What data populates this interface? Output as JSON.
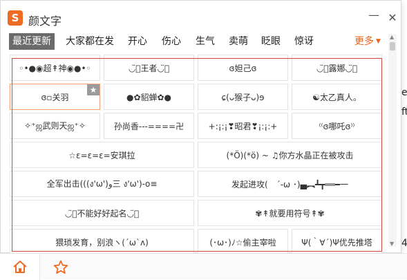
{
  "window": {
    "logo_letter": "S",
    "title": "颜文字",
    "minimize_glyph": "—",
    "close_glyph": "✕"
  },
  "tabs": [
    {
      "label": "最近更新",
      "active": true
    },
    {
      "label": "大家都在发"
    },
    {
      "label": "开心"
    },
    {
      "label": "伤心"
    },
    {
      "label": "生气"
    },
    {
      "label": "卖萌"
    },
    {
      "label": "眨眼"
    },
    {
      "label": "惊讶"
    },
    {
      "label": "更多",
      "more": true
    }
  ],
  "grid": [
    {
      "text": "◦•●◉超↟神◉●•◦"
    },
    {
      "text": "◡̈⃝王者◡̈⃝"
    },
    {
      "text": "ɞ妲己ɞ"
    },
    {
      "text": "◡̈⃝露娜◡̈⃝"
    },
    {
      "text": "ɞ▫关羽",
      "selected": true
    },
    {
      "text": "●✿貂蝉✿●"
    },
    {
      "text": "ɕ(ᴗ猴子ᴗ)ɘ"
    },
    {
      "text": "☯太乙真人。"
    },
    {
      "text": "✧⁺ஜ武则天ஜ⁺✧"
    },
    {
      "text": "孙尚香---====卍"
    },
    {
      "text": "+:¡:¡❣昭君❣¡:¡:+"
    },
    {
      "text": "⁽⁽ɞ哪吒ɞ⁾⁾"
    },
    {
      "text": "☆ε=ε=ε=安琪拉"
    },
    {
      "text": "(*Ö)(*ö) ~ ♫你方水晶正在被攻击"
    },
    {
      "text": "全军出击(((ง'ω')و三 ง'ω')-o≡"
    },
    {
      "text": "发起进攻(　´-ω ･)▄︻┻┳══━一"
    },
    {
      "text": "◡̈⃝不能好好起名◡̈⃝"
    },
    {
      "text": "✾↟就要用符号↟✾"
    },
    {
      "text": "猥琐发育，别浪ヽ(´ω`ʌ)"
    },
    {
      "text": "(･ω･)ﾉ☆偷主宰啦"
    },
    {
      "text": "Ψ(｀∀´)Ψ优先推塔"
    }
  ],
  "selected_badge_icon": "star-icon",
  "background_text": [
    "e",
    "ft",
    "4"
  ],
  "bottom": {
    "home_icon": "home-icon",
    "favorite_icon": "star-outline-icon"
  },
  "colors": {
    "brand": "#ee6b25",
    "active_tab_bg": "#6b6b6b",
    "more_tab": "#e8641a",
    "highlight_frame": "#d6463c"
  }
}
